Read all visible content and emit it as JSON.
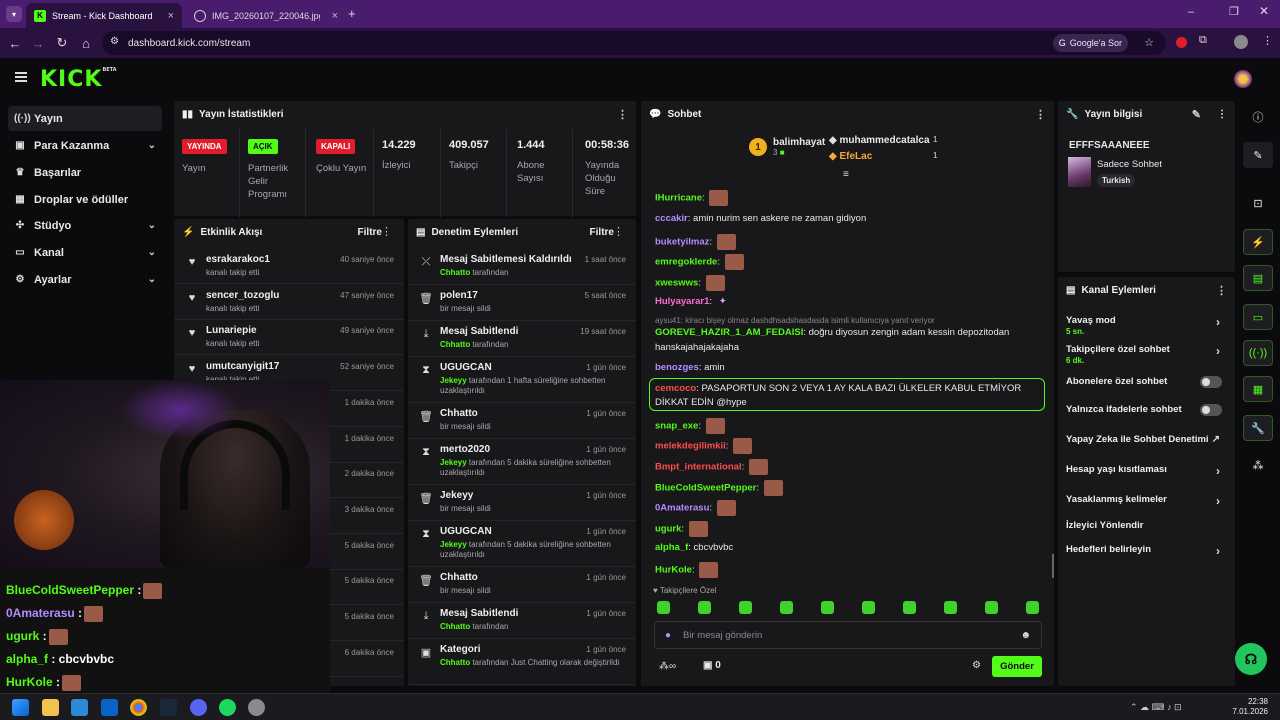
{
  "browser": {
    "tabs": [
      {
        "title": "Stream - Kick Dashboard",
        "active": true
      },
      {
        "title": "IMG_20260107_220046.jpg (91",
        "active": false
      }
    ],
    "url": "dashboard.kick.com/stream",
    "search_chip": "Google'a Sor"
  },
  "header": {
    "logo": "KICK",
    "logo_badge": "BETA"
  },
  "sidebar": {
    "items": [
      {
        "label": "Yayın",
        "icon": "broadcast-icon",
        "active": true
      },
      {
        "label": "Para Kazanma",
        "icon": "wallet-icon",
        "chevron": true
      },
      {
        "label": "Başarılar",
        "icon": "trophy-icon"
      },
      {
        "label": "Droplar ve ödüller",
        "icon": "gift-icon"
      },
      {
        "label": "Stüdyo",
        "icon": "studio-icon",
        "chevron": true
      },
      {
        "label": "Kanal",
        "icon": "channel-icon",
        "chevron": true
      },
      {
        "label": "Ayarlar",
        "icon": "gear-icon",
        "chevron": true
      }
    ]
  },
  "stats": {
    "title": "Yayın İstatistikleri",
    "cells": [
      {
        "badge": "YAYINDA",
        "badge_color": "#e11d2c",
        "label": "Yayın"
      },
      {
        "badge": "AÇIK",
        "badge_color": "#53fc18",
        "label": "Partnerlik Gelir Programı"
      },
      {
        "badge": "KAPALI",
        "badge_color": "#e11d2c",
        "label": "Çoklu Yayın"
      },
      {
        "value": "14.229",
        "label": "İzleyici"
      },
      {
        "value": "409.057",
        "label": "Takipçi"
      },
      {
        "value": "1.444",
        "label": "Abone Sayısı"
      },
      {
        "value": "00:58:36",
        "label": "Yayında Olduğu Süre"
      }
    ]
  },
  "activity": {
    "title": "Etkinlik Akışı",
    "filter": "Filtre",
    "items": [
      {
        "name": "esrakarakoc1",
        "sub": "kanalı takip etti",
        "time": "40 saniye önce"
      },
      {
        "name": "sencer_tozoglu",
        "sub": "kanalı takip etti",
        "time": "47 saniye önce"
      },
      {
        "name": "Lunariepie",
        "sub": "kanalı takip etti",
        "time": "49 saniye önce"
      },
      {
        "name": "umutcanyigit17",
        "sub": "kanalı takip etti",
        "time": "52 saniye önce"
      },
      {
        "name": "",
        "sub": "",
        "time": "1 dakika önce"
      },
      {
        "name": "",
        "sub": "",
        "time": "1 dakika önce"
      },
      {
        "name": "",
        "sub": "",
        "time": "2 dakika önce"
      },
      {
        "name": "",
        "sub": "",
        "time": "3 dakika önce"
      },
      {
        "name": "",
        "sub": "",
        "time": "5 dakika önce"
      },
      {
        "name": "musatkn34",
        "sub": "kanalı takip etti",
        "time": "5 dakika önce"
      },
      {
        "name": "eremnm",
        "sub": "kanalı takip etti",
        "time": "5 dakika önce"
      },
      {
        "name": "panko10on",
        "sub": "kanalı takip etti",
        "time": "6 dakika önce"
      }
    ]
  },
  "moderation": {
    "title": "Denetim Eylemleri",
    "filter": "Filtre",
    "items": [
      {
        "icon": "unpin-icon",
        "title": "Mesaj Sabitlemesi Kaldırıldı",
        "actor": "Chhatto",
        "sub": " tarafından",
        "time": "1 saat önce"
      },
      {
        "icon": "trash-icon",
        "title": "polen17",
        "actor": "",
        "sub": "bir mesajı sildi",
        "time": "5 saat önce"
      },
      {
        "icon": "pin-icon",
        "title": "Mesaj Sabitlendi",
        "actor": "Chhatto",
        "sub": " tarafından",
        "time": "19 saat önce"
      },
      {
        "icon": "hourglass-icon",
        "title": "UGUGCAN",
        "actor": "Jekeyy",
        "sub": " tarafından 1 hafta süreliğine sohbetten uzaklaştırıldı",
        "time": "1 gün önce"
      },
      {
        "icon": "trash-icon",
        "title": "Chhatto",
        "actor": "",
        "sub": "bir mesajı sildi",
        "time": "1 gün önce"
      },
      {
        "icon": "hourglass-icon",
        "title": "merto2020",
        "actor": "Jekeyy",
        "sub": " tarafından 5 dakika süreliğine sohbetten uzaklaştırıldı",
        "time": "1 gün önce"
      },
      {
        "icon": "trash-icon",
        "title": "Jekeyy",
        "actor": "",
        "sub": "bir mesajı sildi",
        "time": "1 gün önce"
      },
      {
        "icon": "hourglass-icon",
        "title": "UGUGCAN",
        "actor": "Jekeyy",
        "sub": " tarafından 5 dakika süreliğine sohbetten uzaklaştırıldı",
        "time": "1 gün önce"
      },
      {
        "icon": "trash-icon",
        "title": "Chhatto",
        "actor": "",
        "sub": "bir mesajı sildi",
        "time": "1 gün önce"
      },
      {
        "icon": "pin-icon",
        "title": "Mesaj Sabitlendi",
        "actor": "Chhatto",
        "sub": " tarafından",
        "time": "1 gün önce"
      },
      {
        "icon": "category-icon",
        "title": "Kategori",
        "actor": "Chhatto",
        "sub": " tarafından Just Chatting olarak değiştirildi",
        "time": "1 gün önce"
      }
    ]
  },
  "chat": {
    "title": "Sohbet",
    "top_gifters": [
      {
        "rank": "1",
        "name": "balimhayat",
        "count": "3"
      },
      {
        "name": "muhammedcatalca",
        "count": "1"
      },
      {
        "name": "EfeLac",
        "count": "1"
      }
    ],
    "messages": [
      {
        "user": "lHurricane",
        "color": "#53fc18",
        "text": "",
        "emote": true
      },
      {
        "user": "cccakir",
        "color": "#b48cff",
        "text": "amin nurim sen askere ne zaman gidiyon"
      },
      {
        "user": "buketyilmaz",
        "color": "#b48cff",
        "text": "",
        "emote": true
      },
      {
        "user": "emregoklerde",
        "color": "#53fc18",
        "text": "",
        "emote": true
      },
      {
        "user": "xweswws",
        "color": "#53fc18",
        "text": "",
        "emote": true
      },
      {
        "user": "Hulyayarar1",
        "color": "#ff6ad5",
        "text": "",
        "emote": false
      },
      {
        "user": "",
        "color": "#888",
        "text": "aysu41: kiracı bişey olmaz dashdhsadshasdasda isimli kullanıcıya yanıt veriyor"
      },
      {
        "user": "GOREVE_HAZIR_1_AM_FEDAISI",
        "color": "#53fc18",
        "text": "doğru diyosun zengin adam kessin depozitodan"
      },
      {
        "user": "",
        "color": "#e8e8ea",
        "text": "hanskajahajakajaha"
      },
      {
        "user": "benozges",
        "color": "#b48cff",
        "text": "amin"
      },
      {
        "user": "cemcoco",
        "color": "#ff4d4d",
        "text": "PASAPORTUN SON 2 VEYA 1 AY KALA BAZI ÜLKELER KABUL ETMİYOR"
      },
      {
        "user": "",
        "color": "#e8e8ea",
        "text": "DİKKAT EDİN @hype"
      },
      {
        "user": "snap_exe",
        "color": "#53fc18",
        "text": "",
        "emote": true
      },
      {
        "user": "melekdegilimkii",
        "color": "#ff4d4d",
        "text": "",
        "emote": true
      },
      {
        "user": "Bmpt_international",
        "color": "#ff4d4d",
        "text": "",
        "emote": true
      },
      {
        "user": "BlueColdSweetPepper",
        "color": "#53fc18",
        "text": "",
        "emote": true
      },
      {
        "user": "0Amaterasu",
        "color": "#b48cff",
        "text": "",
        "emote": true
      },
      {
        "user": "ugurk",
        "color": "#53fc18",
        "text": "",
        "emote": true
      },
      {
        "user": "alpha_f",
        "color": "#53fc18",
        "text": "cbcvbvbc"
      },
      {
        "user": "HurKole",
        "color": "#53fc18",
        "text": "",
        "emote": true
      }
    ],
    "followers_only": "Takipçilere Özel",
    "input_placeholder": "Bir mesaj gönderin",
    "points": "0",
    "send": "Gönder"
  },
  "stream_info": {
    "title": "Yayın bilgisi",
    "stream_title": "EFFFSAAANEEE",
    "category": "Sadece Sohbet",
    "tag": "Turkish"
  },
  "channel_actions": {
    "title": "Kanal Eylemleri",
    "items": [
      {
        "label": "Yavaş mod",
        "value": "5 sn.",
        "control": "chevron"
      },
      {
        "label": "Takipçilere özel sohbet",
        "value": "6 dk.",
        "control": "chevron"
      },
      {
        "label": "Abonelere özel sohbet",
        "control": "toggle"
      },
      {
        "label": "Yalnızca ifadelerle sohbet",
        "control": "toggle"
      },
      {
        "label": "Yapay Zeka ile Sohbet Denetimi",
        "control": "external"
      },
      {
        "label": "Hesap yaşı kısıtlaması",
        "control": "chevron"
      },
      {
        "label": "Yasaklanmış kelimeler",
        "control": "chevron"
      },
      {
        "label": "İzleyici Yönlendir",
        "control": "none"
      },
      {
        "label": "Hedefleri belirleyin",
        "control": "chevron"
      }
    ]
  },
  "overlay_chat": [
    {
      "user": "BlueColdSweetPepper",
      "sep": " :",
      "color": "#53fc18"
    },
    {
      "user": "0Amaterasu",
      "sep": " :",
      "color": "#b48cff"
    },
    {
      "user": "ugurk",
      "sep": " :",
      "color": "#53fc18"
    },
    {
      "user": "alpha_f",
      "sep": " : cbcvbvbc",
      "color": "#53fc18"
    },
    {
      "user": "HurKole",
      "sep": " :",
      "color": "#53fc18"
    }
  ],
  "taskbar": {
    "time": "22:38",
    "date": "7.01.2026"
  },
  "colors": {
    "accent": "#53fc18",
    "panel": "#18181b",
    "bg": "#0b0b0d"
  }
}
